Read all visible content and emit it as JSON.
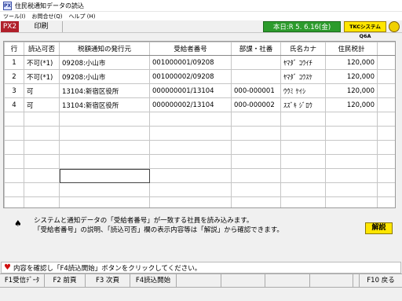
{
  "window": {
    "title": "住民税通知データの読込",
    "icon": "app-icon"
  },
  "menu": [
    "ツール(I)",
    "お問合せ(Q)",
    "ヘルプ (H)"
  ],
  "toolbar": {
    "px_label": "PX2",
    "print_label": "印刷",
    "date_label": "本日:R 5. 6.16(金)",
    "system_label": "TKCシステムQ6A"
  },
  "table": {
    "headers": [
      "行",
      "読込可否",
      "税額通知の発行元",
      "受給者番号",
      "部課・社番",
      "氏名カナ",
      "住民税計"
    ],
    "rows": [
      [
        "1",
        "不可(*1)",
        "09208:小山市",
        "001000001/09208",
        "",
        "ﾔﾏﾀﾞ ｺｳｲﾁ",
        "120,000"
      ],
      [
        "2",
        "不可(*1)",
        "09208:小山市",
        "001000002/09208",
        "",
        "ﾔﾏﾀﾞ ｺｳｽｹ",
        "120,000"
      ],
      [
        "3",
        "可",
        "13104:新宿区役所",
        "000000001/13104",
        "000-000001",
        "ｳｳﾐ ｹｲｼ",
        "120,000"
      ],
      [
        "4",
        "可",
        "13104:新宿区役所",
        "000000002/13104",
        "000-000002",
        "ｽｽﾞｷ ｼﾞﾛｳ",
        "120,000"
      ]
    ]
  },
  "notice": {
    "line1": "システムと通知データの「受給者番号」が一致する社員を読み込みます。",
    "line2": "「受給者番号」の説明、「読込可否」欄の表示内容等は「解説」から確認できます。",
    "help_label": "解説"
  },
  "status": {
    "message": "内容を確認し「F4読込開始」ボタンをクリックしてください。"
  },
  "fkeys": {
    "f1": "F1受信ﾃﾞｰﾀ",
    "f2": "F2 前頁",
    "f3": "F3 次頁",
    "f4": "F4読込開始",
    "f5": "",
    "f6": "",
    "f7": "",
    "f8": "",
    "f9": "",
    "f10": "F10 戻る"
  }
}
